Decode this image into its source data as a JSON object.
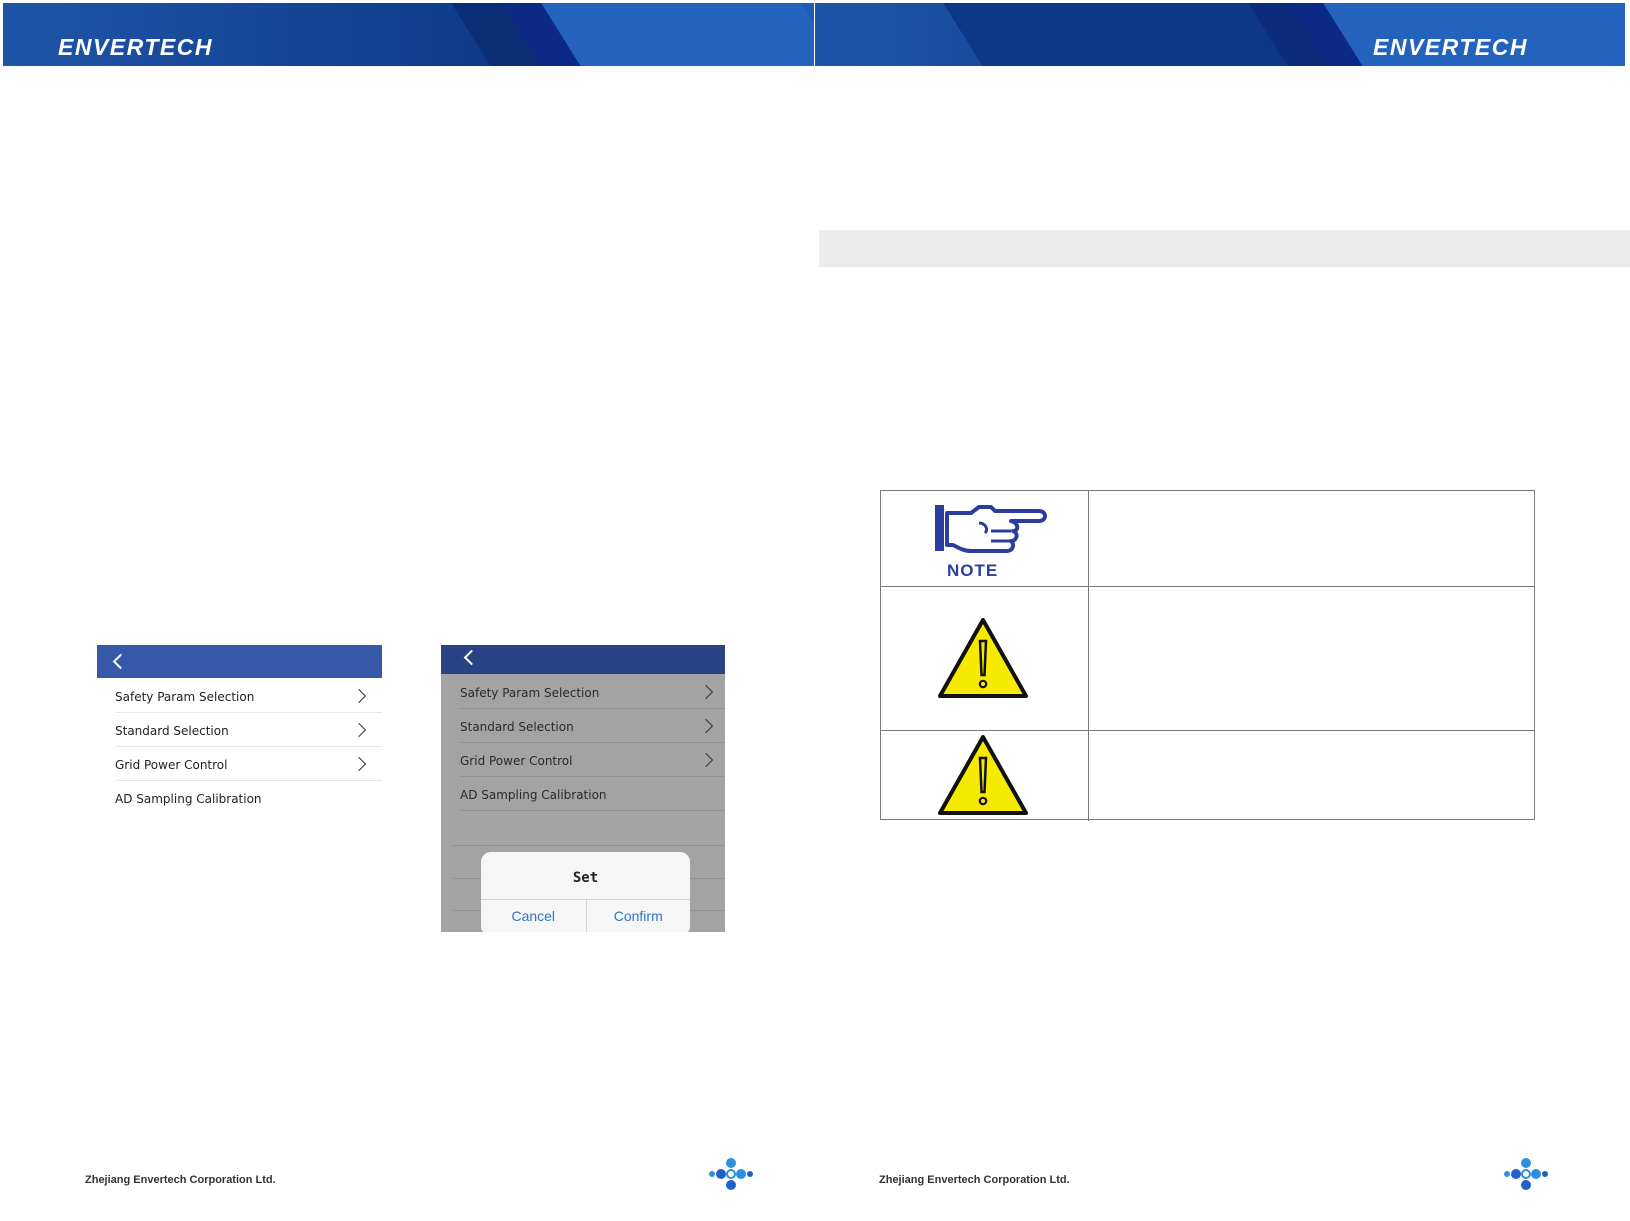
{
  "brand": {
    "name": "ENVERTECH"
  },
  "footer": {
    "company": "Zhejiang Envertech Corporation Ltd."
  },
  "screens": [
    {
      "items": [
        {
          "label": "Safety Param Selection",
          "has_chevron": true
        },
        {
          "label": "Standard Selection",
          "has_chevron": true
        },
        {
          "label": "Grid Power Control",
          "has_chevron": true
        },
        {
          "label": "AD Sampling Calibration",
          "has_chevron": false
        }
      ]
    },
    {
      "items": [
        {
          "label": "Safety Param Selection",
          "has_chevron": true
        },
        {
          "label": "Standard Selection",
          "has_chevron": true
        },
        {
          "label": "Grid Power Control",
          "has_chevron": true
        },
        {
          "label": "AD Sampling Calibration",
          "has_chevron": false
        }
      ],
      "dialog": {
        "title": "Set",
        "cancel": "Cancel",
        "confirm": "Confirm"
      }
    }
  ],
  "notices": [
    {
      "icon": "pointing-hand-icon",
      "label": "NOTE"
    },
    {
      "icon": "warning-triangle-icon"
    },
    {
      "icon": "warning-triangle-icon"
    }
  ],
  "colors": {
    "banner": "#1f55a8",
    "phone_header": "#3559a8",
    "phone_header_dim": "#2a4286",
    "dialog_accent": "#2d76c8",
    "warning_yellow": "#f6ea00",
    "note_blue": "#2b3e9f"
  }
}
